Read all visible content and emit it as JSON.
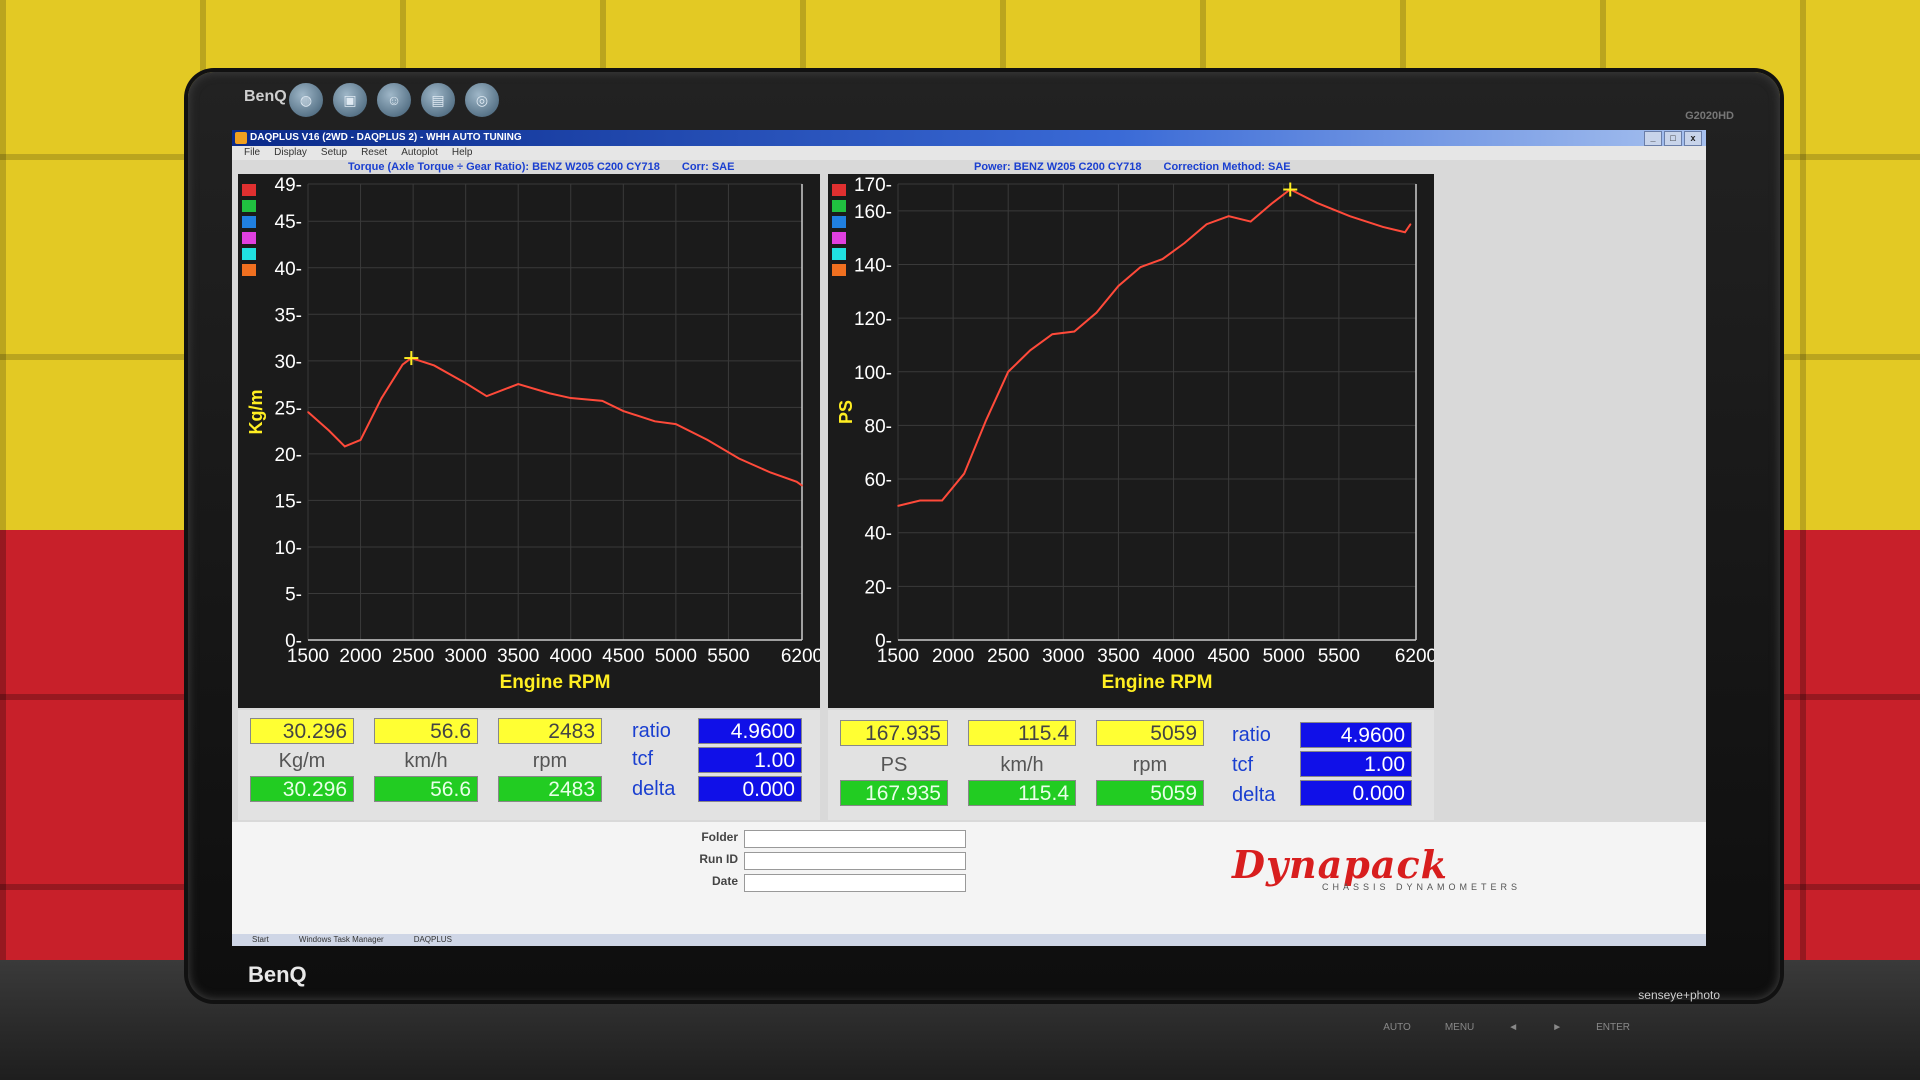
{
  "window": {
    "title": "DAQPLUS V16 (2WD - DAQPLUS 2) - WHH AUTO TUNING",
    "controls": [
      "_",
      "□",
      "x"
    ]
  },
  "menu": [
    "File",
    "Display",
    "Setup",
    "Reset",
    "Autoplot",
    "Help"
  ],
  "monitor": {
    "brand": "BenQ",
    "model": "G2020HD",
    "senseye": "senseye+photo",
    "buttons": [
      "AUTO",
      "MENU",
      "◄",
      "►",
      "ENTER"
    ]
  },
  "torque_chart": {
    "header": "Torque (Axle Torque ÷ Gear Ratio): BENZ W205 C200 CY718",
    "corr": "Corr: SAE",
    "legend_colors": [
      "#e03030",
      "#20c040",
      "#2080e0",
      "#e040e0",
      "#20e0e0",
      "#f07020"
    ]
  },
  "power_chart": {
    "header": "Power: BENZ W205 C200 CY718",
    "corr": "Correction Method: SAE",
    "legend_colors": [
      "#e03030",
      "#20c040",
      "#2080e0",
      "#e040e0",
      "#20e0e0",
      "#f07020"
    ]
  },
  "chart_data": [
    {
      "type": "line",
      "xlabel": "Engine RPM",
      "ylabel": "Kg/m",
      "x_ticks": [
        "1500",
        "2000",
        "2500",
        "3000",
        "3500",
        "4000",
        "4500",
        "5000",
        "5500",
        "6200"
      ],
      "y_ticks": [
        "0",
        "5",
        "10",
        "15",
        "20",
        "25",
        "30",
        "35",
        "40",
        "45",
        "49"
      ],
      "xlim": [
        1500,
        6200
      ],
      "ylim": [
        0,
        49
      ],
      "grid": true,
      "series": [
        {
          "color": "#ff4a3a",
          "x": [
            1500,
            1700,
            1850,
            2000,
            2200,
            2400,
            2483,
            2700,
            3000,
            3200,
            3500,
            3800,
            4000,
            4300,
            4500,
            4800,
            5000,
            5300,
            5600,
            5900,
            6150,
            6200
          ],
          "y": [
            24.5,
            22.5,
            20.8,
            21.5,
            26.0,
            29.6,
            30.3,
            29.5,
            27.6,
            26.2,
            27.5,
            26.5,
            26.0,
            25.7,
            24.6,
            23.5,
            23.2,
            21.5,
            19.5,
            18.0,
            17.0,
            16.6
          ]
        }
      ],
      "marker": {
        "x": 2483,
        "y": 30.296
      }
    },
    {
      "type": "line",
      "xlabel": "Engine RPM",
      "ylabel": "PS",
      "x_ticks": [
        "1500",
        "2000",
        "2500",
        "3000",
        "3500",
        "4000",
        "4500",
        "5000",
        "5500",
        "6200"
      ],
      "y_ticks": [
        "0",
        "20",
        "40",
        "60",
        "80",
        "100",
        "120",
        "140",
        "160",
        "170"
      ],
      "xlim": [
        1500,
        6200
      ],
      "ylim": [
        0,
        170
      ],
      "grid": true,
      "series": [
        {
          "color": "#ff4a3a",
          "x": [
            1500,
            1700,
            1900,
            2100,
            2300,
            2500,
            2700,
            2900,
            3100,
            3300,
            3500,
            3700,
            3900,
            4100,
            4300,
            4500,
            4700,
            4900,
            5059,
            5300,
            5600,
            5900,
            6100,
            6150
          ],
          "y": [
            50,
            52,
            52,
            62,
            82,
            100,
            108,
            114,
            115,
            122,
            132,
            139,
            142,
            148,
            155,
            158,
            156,
            163,
            168,
            163,
            158,
            154,
            152,
            155
          ]
        }
      ],
      "marker": {
        "x": 5059,
        "y": 167.935
      }
    }
  ],
  "torque_readouts": {
    "peak_torque": "30.296",
    "peak_speed": "56.6",
    "peak_rpm": "2483",
    "cur_torque": "30.296",
    "cur_speed": "56.6",
    "cur_rpm": "2483",
    "unit_torque": "Kg/m",
    "unit_speed": "km/h",
    "unit_rpm": "rpm",
    "key_ratio": "ratio",
    "key_tcf": "tcf",
    "key_delta": "delta",
    "ratio": "4.9600",
    "tcf": "1.00",
    "delta": "0.000"
  },
  "power_readouts": {
    "peak_power": "167.935",
    "peak_speed": "115.4",
    "peak_rpm": "5059",
    "cur_power": "167.935",
    "cur_speed": "115.4",
    "cur_rpm": "5059",
    "unit_power": "PS",
    "unit_speed": "km/h",
    "unit_rpm": "rpm",
    "key_ratio": "ratio",
    "key_tcf": "tcf",
    "key_delta": "delta",
    "ratio": "4.9600",
    "tcf": "1.00",
    "delta": "0.000"
  },
  "run_fields": {
    "folder_label": "Folder",
    "runid_label": "Run ID",
    "date_label": "Date"
  },
  "logo": {
    "name": "Dynapack",
    "tagline": "CHASSIS DYNAMOMETERS"
  },
  "taskbar": [
    "Start",
    "Windows Task Manager",
    "DAQPLUS"
  ]
}
